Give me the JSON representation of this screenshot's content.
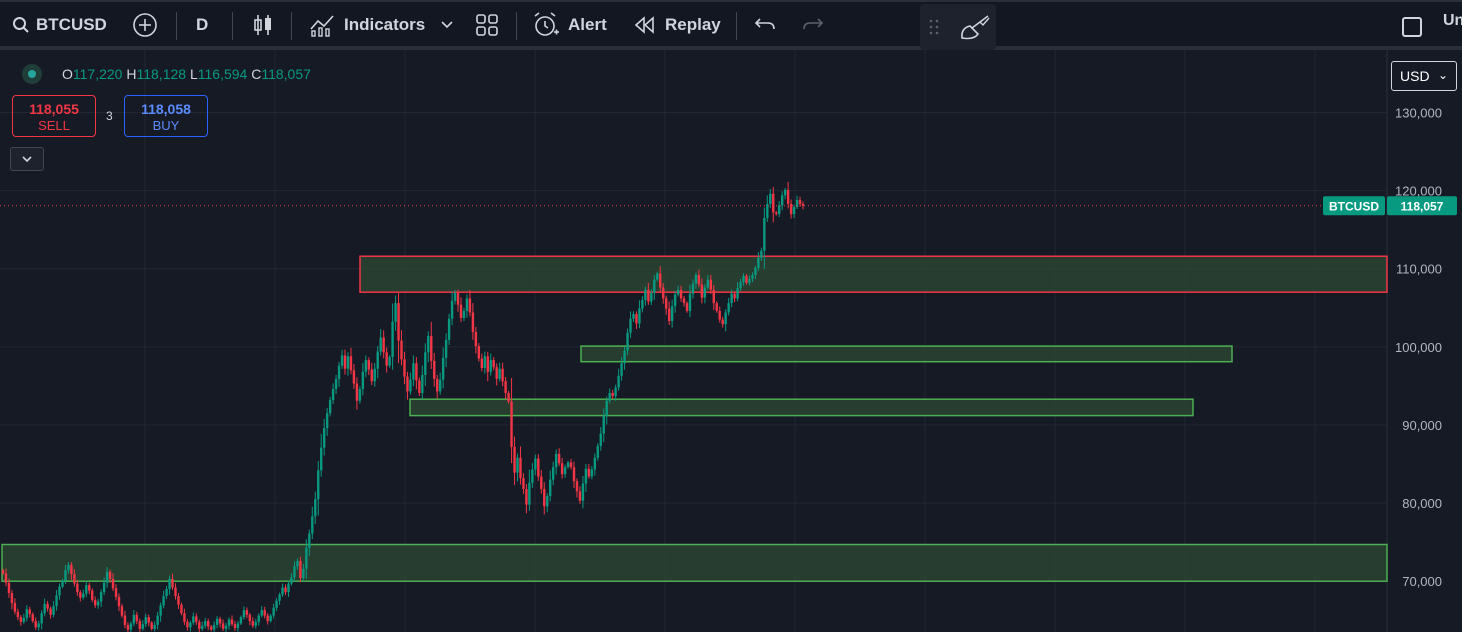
{
  "toolbar": {
    "symbol": "BTCUSD",
    "interval": "D",
    "indicators_label": "Indicators",
    "alert_label": "Alert",
    "replay_label": "Replay",
    "right_label_partial": "Un"
  },
  "legend": {
    "o_key": "O",
    "o_val": "117,220",
    "h_key": "H",
    "h_val": "118,128",
    "l_key": "L",
    "l_val": "116,594",
    "c_key": "C",
    "c_val": "118,057"
  },
  "trade": {
    "sell_price": "118,055",
    "sell_label": "SELL",
    "buy_price": "118,058",
    "buy_label": "BUY",
    "spread": "3"
  },
  "currency": "USD",
  "price_tag": {
    "symbol": "BTCUSD",
    "value": "118,057"
  },
  "colors": {
    "up": "#089981",
    "down": "#f23645",
    "zone_fill": "#2e4a33",
    "zone_green": "#4caf50",
    "zone_red": "#f23645",
    "accent": "#26a69a"
  },
  "chart_data": {
    "type": "candlestick",
    "ylim": [
      63500,
      138000
    ],
    "y_ticks": [
      70000,
      80000,
      90000,
      100000,
      110000,
      120000,
      130000
    ],
    "y_tick_labels": [
      "70,000",
      "80,000",
      "90,000",
      "100,000",
      "110,000",
      "120,000",
      "130,000"
    ],
    "last_price": 118057,
    "candle_count": 270,
    "closes": [
      71000,
      69800,
      68500,
      67200,
      66100,
      65400,
      64800,
      65300,
      66400,
      65800,
      64900,
      64100,
      64600,
      65900,
      67100,
      66500,
      65700,
      66800,
      68200,
      69300,
      70100,
      71400,
      72100,
      70900,
      69700,
      68600,
      67900,
      68400,
      69500,
      68800,
      67600,
      66900,
      67400,
      68600,
      69800,
      71200,
      70300,
      69100,
      68000,
      66800,
      65600,
      64400,
      63800,
      64600,
      65700,
      64900,
      63900,
      64500,
      65400,
      64700,
      63900,
      64400,
      65600,
      66900,
      68100,
      69000,
      70300,
      69200,
      68100,
      67000,
      65900,
      64800,
      64100,
      64700,
      65500,
      64800,
      63900,
      64300,
      64900,
      64200,
      63800,
      64400,
      65200,
      64600,
      63900,
      64300,
      65100,
      64500,
      64000,
      64600,
      65400,
      66300,
      65700,
      64900,
      64300,
      64800,
      65600,
      66300,
      65600,
      64900,
      65600,
      66600,
      67500,
      68300,
      69200,
      68600,
      69700,
      70500,
      71900,
      72600,
      70400,
      71600,
      74300,
      76100,
      78300,
      80500,
      84200,
      87100,
      89600,
      91500,
      93200,
      94600,
      95900,
      97600,
      98900,
      97200,
      98800,
      97000,
      95300,
      93100,
      94600,
      96800,
      98300,
      97100,
      95600,
      97200,
      99400,
      101200,
      99300,
      97600,
      98700,
      103200,
      105600,
      100800,
      98400,
      96200,
      94300,
      95800,
      97900,
      95700,
      94100,
      96400,
      99300,
      101400,
      98200,
      95900,
      94300,
      95800,
      98600,
      100900,
      103600,
      105900,
      106900,
      105400,
      103700,
      104600,
      106200,
      104400,
      101900,
      100100,
      98500,
      97300,
      98800,
      96800,
      98300,
      97400,
      95900,
      97200,
      95600,
      94100,
      93000,
      87200,
      83900,
      85800,
      83200,
      81800,
      79800,
      82600,
      84300,
      85700,
      83400,
      81800,
      79600,
      80900,
      83000,
      84600,
      86300,
      85100,
      83700,
      84600,
      85200,
      84600,
      82800,
      81500,
      80300,
      82500,
      84400,
      83400,
      84300,
      85800,
      87300,
      88900,
      91200,
      93100,
      94100,
      93700,
      94800,
      96300,
      97900,
      99500,
      101800,
      103600,
      104200,
      103000,
      104900,
      106000,
      107300,
      105800,
      106900,
      108600,
      109400,
      107600,
      106200,
      104900,
      103300,
      105200,
      106700,
      107300,
      106200,
      105600,
      104600,
      106800,
      108100,
      109200,
      108000,
      106300,
      107600,
      108600,
      107300,
      105600,
      104600,
      103500,
      102900,
      104400,
      105600,
      106800,
      106200,
      107500,
      108300,
      109100,
      108200,
      108700,
      109200,
      110100,
      111400,
      112300,
      116500,
      118300,
      119600,
      117200,
      117000,
      118100,
      119400,
      120100,
      118300,
      117000,
      117900,
      118800,
      118300,
      118057
    ]
  }
}
